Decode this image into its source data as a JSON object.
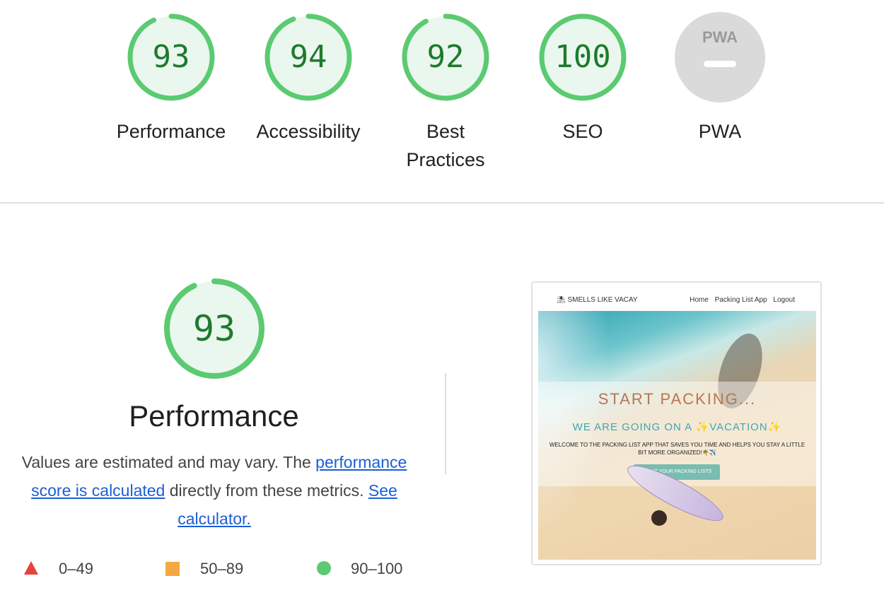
{
  "categories": [
    {
      "label": "Performance",
      "score": "93",
      "value": 93,
      "type": "score"
    },
    {
      "label": "Accessibility",
      "score": "94",
      "value": 94,
      "type": "score"
    },
    {
      "label": "Best Practices",
      "score": "92",
      "value": 92,
      "type": "score"
    },
    {
      "label": "SEO",
      "score": "100",
      "value": 100,
      "type": "score"
    },
    {
      "label": "PWA",
      "score": "",
      "value": null,
      "type": "pwa"
    }
  ],
  "pwa_badge_text": "PWA",
  "performance": {
    "score": "93",
    "value": 93,
    "title": "Performance",
    "desc_prefix": "Values are estimated and may vary. The ",
    "link1": "performance score is calculated",
    "desc_middle": " directly from these metrics. ",
    "link2": "See calculator."
  },
  "legend": [
    {
      "label": "0–49",
      "shape": "triangle",
      "color": "#e8423a"
    },
    {
      "label": "50–89",
      "shape": "square",
      "color": "#f5a742"
    },
    {
      "label": "90–100",
      "shape": "circle",
      "color": "#5bca71"
    }
  ],
  "thumbnail": {
    "brand": "⛱ SMELLS LIKE VACAY",
    "nav_links": [
      "Home",
      "Packing List App",
      "Logout"
    ],
    "hero_title": "START PACKING...",
    "hero_subtitle": "WE ARE GOING ON A ✨VACATION✨",
    "hero_text": "WELCOME TO THE PACKING LIST APP THAT SAVES YOU TIME AND HELPS YOU STAY A LITTLE BIT MORE ORGANIZED!🌴✈️",
    "hero_button": "START YOUR PACKING LISTS"
  },
  "colors": {
    "pass_ring": "#5bca71",
    "pass_fill": "#eaf7ee",
    "pass_text": "#1f7a2f",
    "pwa_gray": "#dadada",
    "link": "#1a5fd6"
  }
}
